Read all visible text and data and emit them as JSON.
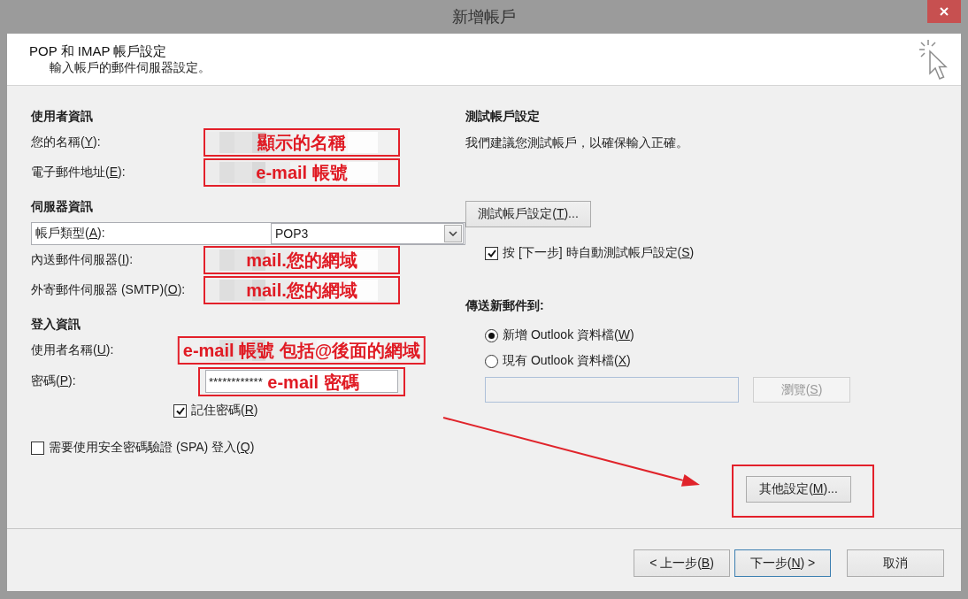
{
  "window": {
    "title": "新增帳戶"
  },
  "header": {
    "title": "POP 和 IMAP 帳戶設定",
    "subtitle": "輸入帳戶的郵件伺服器設定。"
  },
  "account_form": {
    "sections": [
      {
        "heading": "使用者資訊",
        "fields": [
          {
            "kind": "text",
            "label": {
              "pre": "您的名稱(",
              "key": "Y",
              "post": "):"
            },
            "redacted": true,
            "annotation": "顯示的名稱"
          },
          {
            "kind": "text",
            "label": {
              "pre": "電子郵件地址(",
              "key": "E",
              "post": "):"
            },
            "redacted": true,
            "annotation": "e-mail 帳號"
          }
        ]
      },
      {
        "heading": "伺服器資訊",
        "fields": [
          {
            "kind": "select",
            "label": {
              "pre": "帳戶類型(",
              "key": "A",
              "post": "):"
            },
            "value": "POP3"
          },
          {
            "kind": "text",
            "label": {
              "pre": "內送郵件伺服器(",
              "key": "I",
              "post": "):"
            },
            "redacted": true,
            "annotation": "mail.您的網域"
          },
          {
            "kind": "text",
            "label": {
              "pre": "外寄郵件伺服器 (SMTP)(",
              "key": "O",
              "post": "):"
            },
            "redacted": true,
            "annotation": "mail.您的網域"
          }
        ]
      },
      {
        "heading": "登入資訊",
        "fields": [
          {
            "kind": "text",
            "label": {
              "pre": "使用者名稱(",
              "key": "U",
              "post": "):"
            },
            "redacted": true,
            "annotation": "e-mail 帳號 包括@後面的網域"
          },
          {
            "kind": "password",
            "label": {
              "pre": "密碼(",
              "key": "P",
              "post": "):"
            },
            "value": "************",
            "annotation": "e-mail 密碼"
          },
          {
            "kind": "checkbox",
            "label": {
              "pre": "記住密碼(",
              "key": "R",
              "post": ")"
            },
            "checked": true
          }
        ]
      }
    ],
    "spa_checkbox": {
      "label": {
        "pre": "需要使用安全密碼驗證 (SPA) 登入(",
        "key": "Q",
        "post": ")"
      },
      "checked": false
    }
  },
  "test_settings": {
    "heading": "測試帳戶設定",
    "description": "我們建議您測試帳戶，以確保輸入正確。",
    "test_button": {
      "label": {
        "pre": "測試帳戶設定(",
        "key": "T",
        "post": ")..."
      }
    },
    "auto_test_checkbox": {
      "label": {
        "pre": "按 [下一步] 時自動測試帳戶設定(",
        "key": "S",
        "post": ")"
      },
      "checked": true
    },
    "deliver_heading": "傳送新郵件到:",
    "deliver_options": [
      {
        "label": {
          "pre": "新增 Outlook 資料檔(",
          "key": "W",
          "post": ")"
        },
        "selected": true
      },
      {
        "label": {
          "pre": "現有 Outlook 資料檔(",
          "key": "X",
          "post": ")"
        },
        "selected": false
      }
    ],
    "file_path_field": {
      "disabled": true
    },
    "browse_button": {
      "label": {
        "pre": "瀏覽(",
        "key": "S",
        "post": ")"
      },
      "disabled": true
    },
    "more_settings_button": {
      "label": {
        "pre": "其他設定(",
        "key": "M",
        "post": ")..."
      },
      "highlighted": true
    }
  },
  "footer_buttons": [
    {
      "label": {
        "pre": "< 上一步(",
        "key": "B",
        "post": ")"
      },
      "default": false
    },
    {
      "label": {
        "pre": "下一步(",
        "key": "N",
        "post": ") >"
      },
      "default": true
    },
    {
      "label": "取消",
      "default": false
    }
  ]
}
